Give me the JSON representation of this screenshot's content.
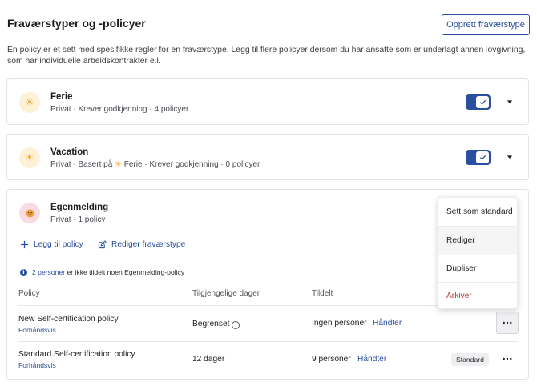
{
  "header": {
    "title": "Fraværstyper og -policyer",
    "create_label": "Opprett fraværstype",
    "intro": "En policy er et sett med spesifikke regler for en fraværstype. Legg til flere policyer dersom du har ansatte som er underlagt annen lovgivning, som har individuelle arbeidskontrakter e.l."
  },
  "absence_types": [
    {
      "name": "Ferie",
      "icon": "sun-icon",
      "subtitle": "Privat · Krever godkjenning · 4 policyer",
      "enabled": true
    },
    {
      "name": "Vacation",
      "icon": "sun-icon",
      "subtitle_prefix": "Privat · Basert på",
      "subtitle_ref": "Ferie",
      "subtitle_suffix": "· Krever godkjenning · 0 policyer",
      "enabled": true
    }
  ],
  "expanded": {
    "name": "Egenmelding",
    "icon": "sick-face-icon",
    "subtitle": "Privat · 1 policy",
    "add_policy_label": "Legg til policy",
    "edit_type_label": "Rediger fraværstype",
    "notice_link": "2 personer",
    "notice_text": "er ikke tildelt noen Egenmelding-policy",
    "columns": {
      "policy": "Policy",
      "days": "Tilgjengelige dager",
      "assigned": "Tildelt"
    },
    "rows": [
      {
        "name": "New Self-certification policy",
        "preview": "Forhåndsvis",
        "days": "Begrenset",
        "assigned": "Ingen personer",
        "manage": "Håndter"
      },
      {
        "name": "Standard Self-certification policy",
        "preview": "Forhåndsvis",
        "days": "12 dager",
        "assigned": "9 personer",
        "manage": "Håndter",
        "badge": "Standard"
      }
    ]
  },
  "context_menu": {
    "items": [
      "Sett som standard",
      "Rediger",
      "Dupliser",
      "Arkiver"
    ]
  },
  "colors": {
    "accent": "#2b4f9f",
    "danger": "#b0383b",
    "sun": "#f0a63a",
    "sick": "#e06a8a"
  }
}
